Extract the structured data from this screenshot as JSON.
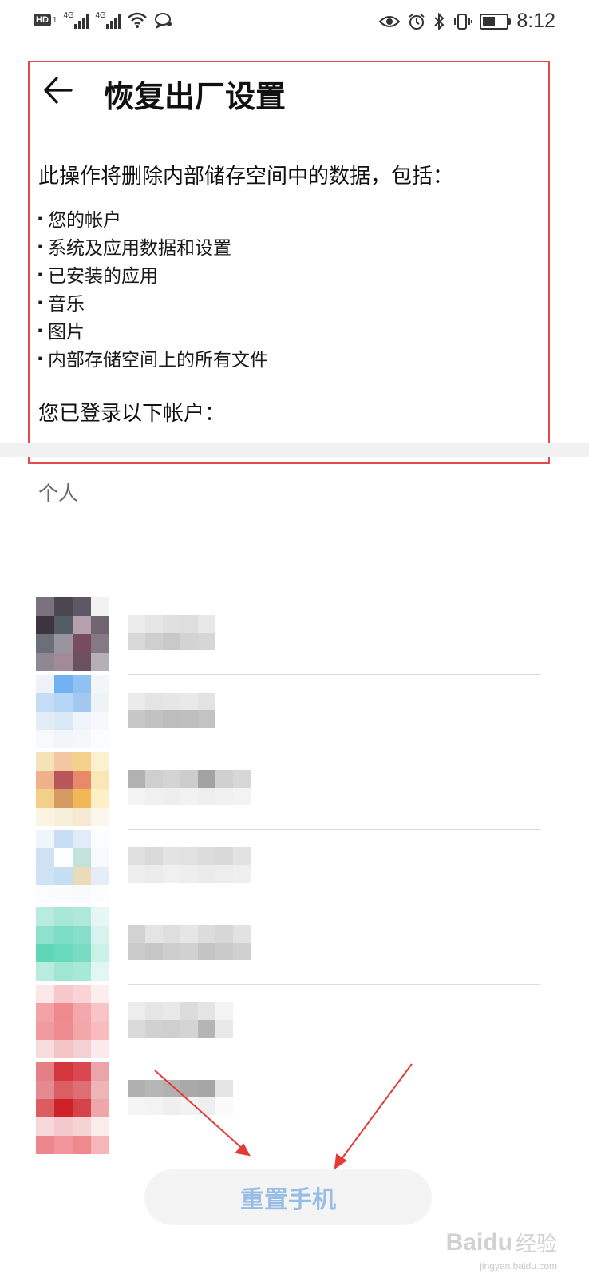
{
  "status_bar": {
    "hd_label": "HD",
    "hd_sub": "1",
    "signal1_label": "4G",
    "signal2_label": "4G",
    "time": "8:12",
    "battery_level": 0.45
  },
  "header": {
    "title": "恢复出厂设置"
  },
  "content": {
    "intro": "此操作将删除内部储存空间中的数据，包括：",
    "items": [
      "您的帐户",
      "系统及应用数据和设置",
      "已安装的应用",
      "音乐",
      "图片",
      "内部存储空间上的所有文件"
    ],
    "accounts_label": "您已登录以下帐户："
  },
  "accounts_section": {
    "header": "个人",
    "accounts": [
      {
        "avatar_colors": [
          "#7b7080",
          "#4b4650",
          "#5e5866",
          "#f2f2f2",
          "#3d3440",
          "#535d66",
          "#b6a0ae",
          "#6f6470",
          "#6b7078",
          "#9a949e",
          "#7a4a5e",
          "#857a84",
          "#8e8894",
          "#a48a98",
          "#6a5060",
          "#b5b0b8"
        ],
        "text_colors": [
          "#ececec",
          "#d8d8d8",
          "#e6e6e6",
          "#cfcfcf",
          "#e0e0e0",
          "#c9c9c9",
          "#dedede",
          "#d3d3d3",
          "#e8e8e8",
          "#d6d6d6"
        ]
      },
      {
        "avatar_colors": [
          "#eef3f9",
          "#6fb2ef",
          "#8fc1f2",
          "#f3f6f9",
          "#c4ddf5",
          "#b5d6f4",
          "#a4c7ef",
          "#eef3f8",
          "#e2edf8",
          "#dbe9f7",
          "#eef4fa",
          "#f6f8fb",
          "#f7f9fb",
          "#f2f6fa",
          "#f5f8fb",
          "#fbfcfd"
        ],
        "text_colors": [
          "#ebebeb",
          "#c7c7c7",
          "#e4e4e4",
          "#c2c2c2",
          "#e6e6e6",
          "#bdbdbd",
          "#e9e9e9",
          "#bfbfbf",
          "#e3e3e3",
          "#c3c3c3"
        ]
      },
      {
        "avatar_colors": [
          "#f5e2b8",
          "#f4c7a0",
          "#f4d28c",
          "#fbf0cf",
          "#efb08b",
          "#b8565a",
          "#e88a6a",
          "#fbe6b6",
          "#f3d08a",
          "#d39a62",
          "#f0b857",
          "#fdf0c6",
          "#fbf4e2",
          "#f8efd8",
          "#f6ead2",
          "#fbf7ec"
        ],
        "text_colors": [
          "#b1b1b1",
          "#f4f4f4",
          "#cfcfcf",
          "#f0f0f0",
          "#d4d4d4",
          "#eeeeee",
          "#cdcdcd",
          "#f2f2f2",
          "#a3a3a3",
          "#efefef",
          "#d0d0d0",
          "#f1f1f1",
          "#d7d7d7",
          "#f3f3f3"
        ]
      },
      {
        "avatar_colors": [
          "#f0f5fb",
          "#c9def4",
          "#e2ecf8",
          "#fbfcfd",
          "#cfe1f3",
          "#ffffff",
          "#c3e2dc",
          "#f7f9fb",
          "#cfe3f4",
          "#c5dff2",
          "#eadcb8",
          "#e4edf8",
          "#fbfcfd",
          "#fafbfd",
          "#f8fafc",
          "#fdfdfe"
        ],
        "text_colors": [
          "#e0e0e0",
          "#eeeeee",
          "#dadada",
          "#ececec",
          "#e3e3e3",
          "#f0f0f0",
          "#e1e1e1",
          "#eeeeee",
          "#dcdcdc",
          "#ebebeb",
          "#d9d9d9",
          "#ededed",
          "#e2e2e2",
          "#efefef"
        ]
      },
      {
        "avatar_colors": [
          "#b9ebe0",
          "#a8e6d8",
          "#b0e8dc",
          "#e6f7f3",
          "#8ee1ca",
          "#7ddcc4",
          "#86dfc8",
          "#d6f4ed",
          "#5fd7b6",
          "#68dabb",
          "#78dcc2",
          "#c9f1e6",
          "#b8ecdf",
          "#9fe6d3",
          "#a7e8d7",
          "#e2f7f1"
        ],
        "text_colors": [
          "#d2d2d2",
          "#cbcbcb",
          "#e4e4e4",
          "#c6c6c6",
          "#dedede",
          "#cecece",
          "#e6e6e6",
          "#d1d1d1",
          "#dcdcdc",
          "#c4c4c4",
          "#d7d7d7",
          "#cacaca",
          "#e2e2e2",
          "#d0d0d0"
        ]
      },
      {
        "avatar_colors": [
          "#fbe7e8",
          "#f7c8ca",
          "#f9d3d5",
          "#fdeeee",
          "#f3a3a6",
          "#ef8a8f",
          "#f3a8ab",
          "#f9c4c6",
          "#f19aa0",
          "#ee8c92",
          "#f2a7aa",
          "#f8bcbf",
          "#f6dcdd",
          "#f2c4c6",
          "#f4d0d2",
          "#fbeaeb"
        ],
        "text_colors": [
          "#ededed",
          "#dadada",
          "#e6e6e6",
          "#d1d1d1",
          "#e9e9e9",
          "#cfcfcf",
          "#dcdcdc",
          "#d4d4d4",
          "#e4e4e4",
          "#b5b5b5",
          "#f4f4f4",
          "#e9e9e9"
        ]
      },
      {
        "avatar_colors": [
          "#e47f85",
          "#d3363c",
          "#d8484e",
          "#eba5a8",
          "#e48a90",
          "#d95f65",
          "#dd6e74",
          "#efb4b7",
          "#dc5c62",
          "#cf2228",
          "#d4424a",
          "#eea6a9",
          "#f6dadb",
          "#f3c9cb",
          "#f5d2d4",
          "#fbecec",
          "#ee878d",
          "#f2959a",
          "#f0898f",
          "#f6b6b9"
        ],
        "text_colors": [
          "#b0b0b0",
          "#f5f5f5",
          "#b6b6b6",
          "#f3f3f3",
          "#b2b2b2",
          "#efefef",
          "#a9a9a9",
          "#f2f2f2",
          "#a6a6a6",
          "#eeeeee",
          "#e4e4e4",
          "#fafafa"
        ]
      }
    ]
  },
  "reset_button": {
    "label": "重置手机"
  },
  "watermark": {
    "logo": "Baidu",
    "suffix": "经验",
    "url": "jingyan.baidu.com"
  },
  "colors": {
    "highlight_frame": "#e24b4b",
    "arrow": "#e53935",
    "button_text": "#97bde6"
  }
}
